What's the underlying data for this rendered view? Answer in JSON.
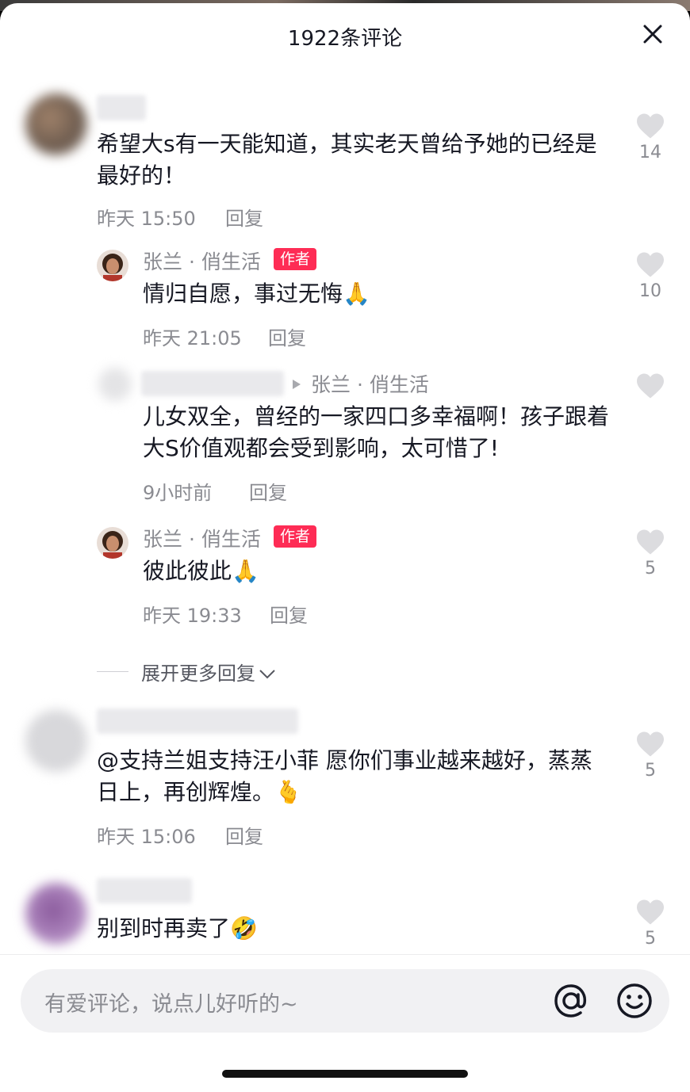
{
  "header": {
    "title": "1922条评论"
  },
  "comments": [
    {
      "text": "希望大s有一天能知道，其实老天曾给予她的已经是最好的！",
      "time": "昨天 15:50",
      "reply": "回复",
      "likes": "14"
    },
    {
      "author": "张兰 · 俏生活",
      "badge": "作者",
      "text": "情归自愿，事过无悔",
      "emoji": "🙏",
      "time": "昨天 21:05",
      "reply": "回复",
      "likes": "10"
    },
    {
      "reply_to": "张兰 · 俏生活",
      "text": "儿女双全，曾经的一家四口多幸福啊！孩子跟着大S价值观都会受到影响，太可惜了!",
      "time": "9小时前",
      "reply": "回复",
      "likes": ""
    },
    {
      "author": "张兰 · 俏生活",
      "badge": "作者",
      "text": "彼此彼此",
      "emoji": "🙏",
      "time": "昨天 19:33",
      "reply": "回复",
      "likes": "5"
    },
    {
      "text": "@支持兰姐支持汪小菲 愿你们事业越来越好，蒸蒸日上，再创辉煌。",
      "emoji": "🫰",
      "time": "昨天 15:06",
      "reply": "回复",
      "likes": "5"
    },
    {
      "text": "别到时再卖了",
      "emoji": "🤣",
      "likes": "5"
    }
  ],
  "expand": {
    "label": "展开更多回复"
  },
  "composer": {
    "placeholder": "有爱评论，说点儿好听的~"
  },
  "colors": {
    "accent": "#fe2c55",
    "muted": "#8a8b91"
  }
}
